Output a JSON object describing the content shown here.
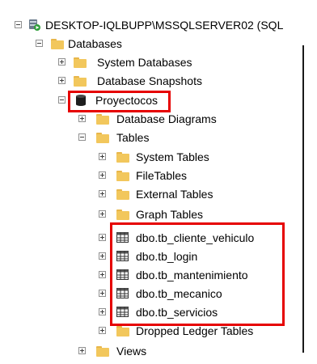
{
  "tree": {
    "server": "DESKTOP-IQLBUPP\\MSSQLSERVER02 (SQL",
    "databases": "Databases",
    "system_databases": "System Databases",
    "database_snapshots": "Database Snapshots",
    "proyectocos": "Proyectocos",
    "database_diagrams": "Database Diagrams",
    "tables": "Tables",
    "system_tables": "System Tables",
    "filetables": "FileTables",
    "external_tables": "External Tables",
    "graph_tables": "Graph Tables",
    "user_tables": [
      "dbo.tb_cliente_vehiculo",
      "dbo.tb_login",
      "dbo.tb_mantenimiento",
      "dbo.tb_mecanico",
      "dbo.tb_servicios"
    ],
    "dropped_ledger_tables": "Dropped Ledger Tables",
    "views": "Views"
  },
  "colors": {
    "highlight": "#e60000",
    "folder": "#f2c75c",
    "server_badge": "#2e9e3a"
  },
  "icons": {
    "server": "server-icon",
    "folder": "folder-icon",
    "database": "database-icon",
    "table": "table-icon"
  }
}
